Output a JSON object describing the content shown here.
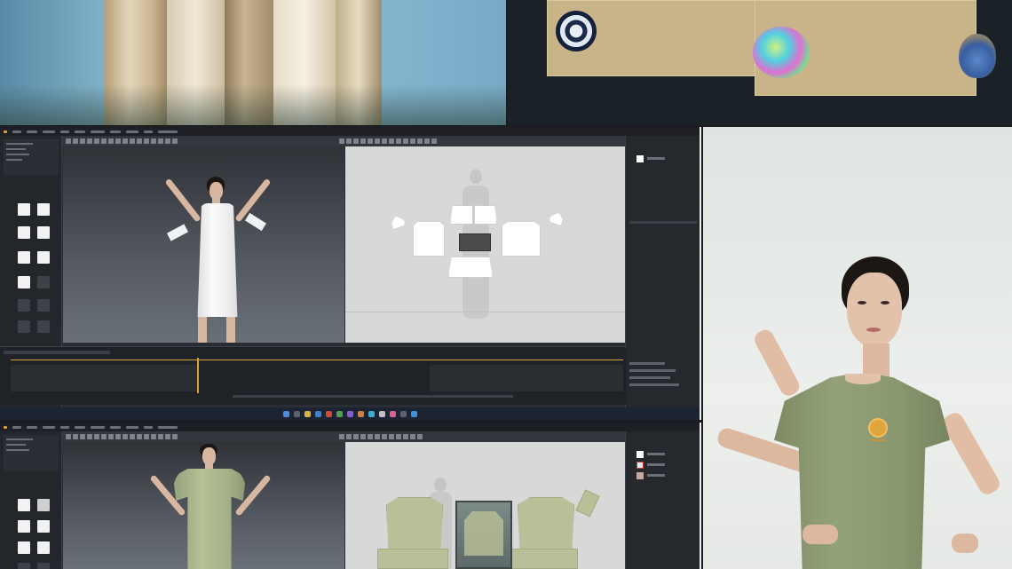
{
  "photos": {
    "top_left": {
      "subject": "fabric-drape",
      "colors": {
        "wall": "#7fb0c6",
        "fabric": "#d9c9a8"
      }
    },
    "top_right": {
      "subject": "fabric-swatches-with-stones",
      "colors": {
        "swatch": "#c9b48a",
        "background": "#1b2227"
      }
    }
  },
  "software_top": {
    "title": "",
    "stage": "white-dress",
    "library_items": 12,
    "colors": {
      "garment": "#f4f4f4",
      "pattern": "#ffffff",
      "ui_bg": "#2a2d33",
      "accent_timeline": "#d8a23a"
    }
  },
  "software_bottom": {
    "title": "",
    "stage": "green-tshirt",
    "colors": {
      "garment": "#a9b58c",
      "pattern": "#b9bf97",
      "ui_bg": "#2a2d33"
    }
  },
  "render": {
    "subject": "avatar-in-olive-tshirt",
    "colors": {
      "shirt": "#8c9a72",
      "logo": "#e0a53a",
      "background": "#e8ebe8"
    }
  }
}
